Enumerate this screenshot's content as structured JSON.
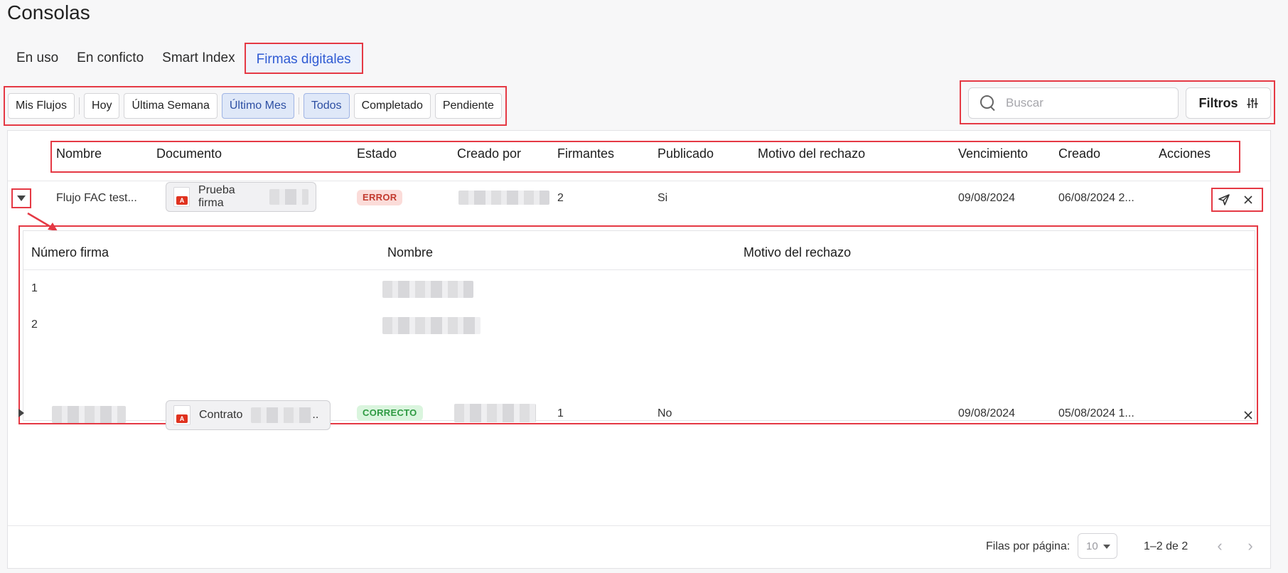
{
  "page": {
    "title": "Consolas"
  },
  "tabs": [
    {
      "label": "En uso",
      "active": false
    },
    {
      "label": "En conficto",
      "active": false
    },
    {
      "label": "Smart Index",
      "active": false
    },
    {
      "label": "Firmas digitales",
      "active": true
    }
  ],
  "quick_filters": {
    "mine": "Mis Flujos",
    "periods": [
      "Hoy",
      "Última Semana",
      "Último Mes"
    ],
    "statuses": [
      "Todos",
      "Completado",
      "Pendiente"
    ],
    "selected_period": "Último Mes",
    "selected_status": "Todos"
  },
  "search": {
    "placeholder": "Buscar",
    "value": ""
  },
  "filters_button": {
    "label": "Filtros",
    "icon": "sliders-icon"
  },
  "table": {
    "headers": [
      "Nombre",
      "Documento",
      "Estado",
      "Creado por",
      "Firmantes",
      "Publicado",
      "Motivo del rechazo",
      "Vencimiento",
      "Creado",
      "Acciones"
    ],
    "rows": [
      {
        "nombre": "Flujo FAC test...",
        "documento": "Prueba firma",
        "estado": "ERROR",
        "firmantes": "2",
        "publicado": "Si",
        "vencimiento": "09/08/2024",
        "creado": "06/08/2024 2...",
        "expanded": true,
        "actions": [
          "send-icon",
          "close-icon"
        ]
      },
      {
        "nombre": "",
        "documento": "Contrato",
        "documento_suffix": "..",
        "estado": "CORRECTO",
        "firmantes": "1",
        "publicado": "No",
        "vencimiento": "09/08/2024",
        "creado": "05/08/2024 1...",
        "expanded": false,
        "actions": [
          "close-icon"
        ]
      }
    ]
  },
  "signers_table": {
    "headers": [
      "Número firma",
      "Nombre",
      "Motivo del rechazo"
    ],
    "rows": [
      {
        "numero": "1"
      },
      {
        "numero": "2"
      }
    ]
  },
  "pagination": {
    "rows_per_page_label": "Filas por página:",
    "rows_per_page": "10",
    "range": "1–2 de 2",
    "prev_icon": "‹",
    "next_icon": "›"
  },
  "colors": {
    "accent": "#2f5bd3",
    "highlight_border": "#e53944",
    "error_bg": "#fbdcd9",
    "error_text": "#c23a2e",
    "ok_bg": "#daf5de",
    "ok_text": "#2e9a42"
  }
}
